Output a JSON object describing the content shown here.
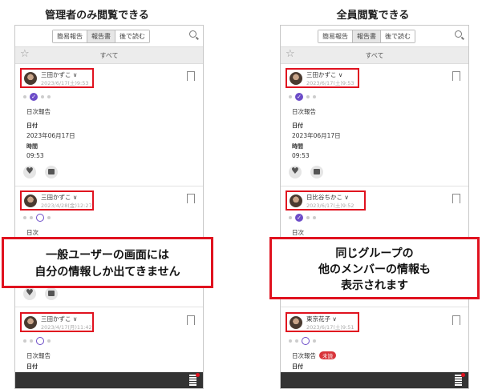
{
  "left": {
    "heading": "管理者のみ閲覧できる",
    "tabs": [
      "簡易報告",
      "報告書",
      "後で読む"
    ],
    "filter_label": "すべて",
    "posts": [
      {
        "author": "三田かずこ ∨",
        "date": "2023/6/17(土)9:53",
        "lines": [
          "日次報告",
          "日付",
          "2023年06月17日",
          "時間",
          "09:53"
        ]
      },
      {
        "author": "三田かずこ ∨",
        "date": "2023/4/28(金)12:27",
        "lines": [
          "日次"
        ]
      },
      {
        "author": "三田かずこ ∨",
        "date": "2023/4/17(月)11:42",
        "lines": [
          "日次報告",
          "日付"
        ]
      }
    ],
    "callout": [
      "一般ユーザーの画面には",
      "自分の情報しか出てきません"
    ]
  },
  "right": {
    "heading": "全員閲覧できる",
    "tabs": [
      "簡易報告",
      "報告書",
      "後で読む"
    ],
    "filter_label": "すべて",
    "posts": [
      {
        "author": "三田かずこ ∨",
        "date": "2023/6/17(土)9:53",
        "lines": [
          "日次報告",
          "日付",
          "2023年06月17日",
          "時間",
          "09:53"
        ]
      },
      {
        "author": "日比谷ちかこ ∨",
        "date": "2023/6/17(土)9:52",
        "lines": [
          "日次"
        ]
      },
      {
        "author": "東京花子 ∨",
        "date": "2023/6/17(土)9:51",
        "lines": [
          "日次報告",
          "日付"
        ],
        "badge": "未読"
      }
    ],
    "callout": [
      "同じグループの",
      "他のメンバーの情報も",
      "表示されます"
    ]
  },
  "colors": {
    "highlight": "#e0121f",
    "accent": "#6c4cc8",
    "unread": "#d8343a"
  }
}
